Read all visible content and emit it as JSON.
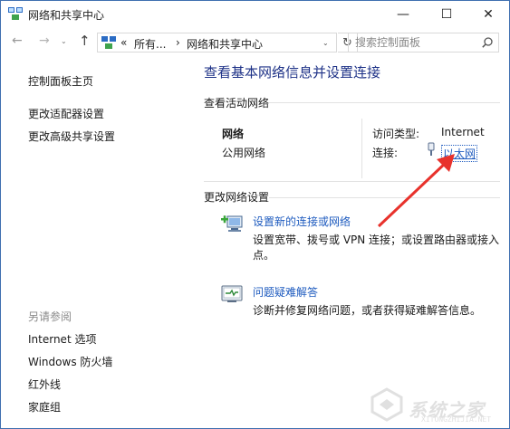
{
  "window": {
    "title": "网络和共享中心"
  },
  "titlebar": {
    "minimize": "—",
    "maximize": "☐",
    "close": "✕"
  },
  "nav": {
    "back": "←",
    "forward": "→",
    "history": "⌄",
    "up": "↑"
  },
  "address": {
    "prefix": "«",
    "parts": [
      "所有...",
      "网络和共享中心"
    ],
    "separator": "›",
    "dropdown": "⌄",
    "refresh": "↻"
  },
  "search": {
    "placeholder": "搜索控制面板"
  },
  "left_pane": {
    "links_top": [
      "控制面板主页",
      "更改适配器设置",
      "更改高级共享设置"
    ],
    "see_also_heading": "另请参阅",
    "links_bottom": [
      "Internet 选项",
      "Windows 防火墙",
      "红外线",
      "家庭组"
    ]
  },
  "main": {
    "title": "查看基本网络信息并设置连接",
    "active_heading": "查看活动网络",
    "network_name": "网络",
    "network_kind": "公用网络",
    "access_type_label": "访问类型:",
    "access_type_value": "Internet",
    "connection_label": "连接:",
    "connection_value": "以太网",
    "change_heading": "更改网络设置",
    "tasks": [
      {
        "link": "设置新的连接或网络",
        "desc": "设置宽带、拨号或 VPN 连接；或设置路由器或接入点。"
      },
      {
        "link": "问题疑难解答",
        "desc": "诊断并修复网络问题，或者获得疑难解答信息。"
      }
    ]
  },
  "watermark": {
    "text": "系统之家",
    "sub": "XITONGZHIJIA.NET"
  },
  "colors": {
    "accent_title": "#1e3287",
    "link": "#1e5bbf",
    "arrow": "#e8322c",
    "border": "#3f6fb0"
  }
}
